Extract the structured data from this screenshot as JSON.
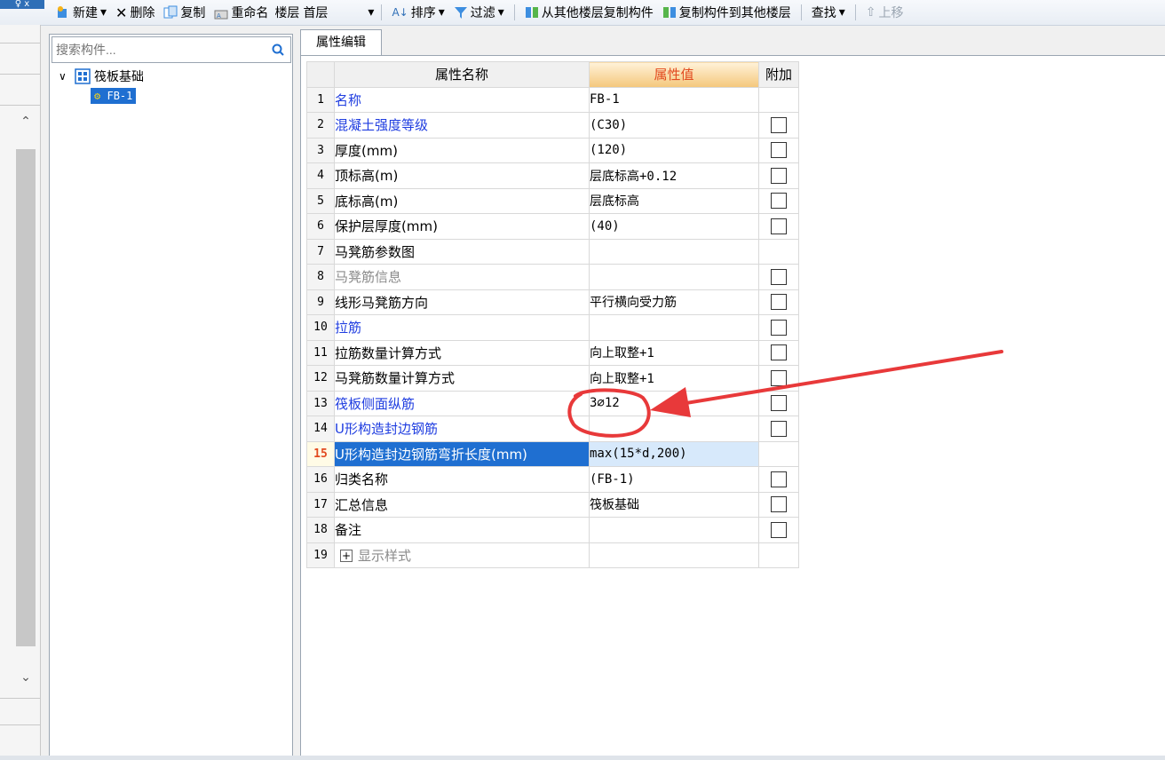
{
  "toolbar": {
    "pin_label": "♀ x",
    "new": "新建",
    "delete": "删除",
    "copy": "复制",
    "rename": "重命名",
    "floor_label": "楼层",
    "floor_value": "首层",
    "sort": "排序",
    "filter": "过滤",
    "copy_from_floor": "从其他楼层复制构件",
    "copy_to_floor": "复制构件到其他楼层",
    "find": "查找",
    "move_up": "上移"
  },
  "components": {
    "search_placeholder": "搜索构件...",
    "tree_root": "筏板基础",
    "tree_child": "FB-1"
  },
  "properties": {
    "tab_label": "属性编辑",
    "headers": {
      "name": "属性名称",
      "value": "属性值",
      "add": "附加"
    },
    "rows": [
      {
        "num": "1",
        "name": "名称",
        "value": "FB-1",
        "checkbox": false,
        "style": "blue"
      },
      {
        "num": "2",
        "name": "混凝土强度等级",
        "value": "(C30)",
        "checkbox": true,
        "style": "blue"
      },
      {
        "num": "3",
        "name": "厚度(mm)",
        "value": "(120)",
        "checkbox": true,
        "style": "normal"
      },
      {
        "num": "4",
        "name": "顶标高(m)",
        "value": "层底标高+0.12",
        "checkbox": true,
        "style": "normal"
      },
      {
        "num": "5",
        "name": "底标高(m)",
        "value": "层底标高",
        "checkbox": true,
        "style": "normal"
      },
      {
        "num": "6",
        "name": "保护层厚度(mm)",
        "value": "(40)",
        "checkbox": true,
        "style": "normal"
      },
      {
        "num": "7",
        "name": "马凳筋参数图",
        "value": "",
        "checkbox": false,
        "style": "normal"
      },
      {
        "num": "8",
        "name": "马凳筋信息",
        "value": "",
        "checkbox": true,
        "style": "gray"
      },
      {
        "num": "9",
        "name": "线形马凳筋方向",
        "value": "平行横向受力筋",
        "checkbox": true,
        "style": "normal"
      },
      {
        "num": "10",
        "name": "拉筋",
        "value": "",
        "checkbox": true,
        "style": "blue"
      },
      {
        "num": "11",
        "name": "拉筋数量计算方式",
        "value": "向上取整+1",
        "checkbox": true,
        "style": "normal"
      },
      {
        "num": "12",
        "name": "马凳筋数量计算方式",
        "value": "向上取整+1",
        "checkbox": true,
        "style": "normal"
      },
      {
        "num": "13",
        "name": "筏板侧面纵筋",
        "value": "3⌀12",
        "checkbox": true,
        "style": "blue"
      },
      {
        "num": "14",
        "name": "U形构造封边钢筋",
        "value": "",
        "checkbox": true,
        "style": "blue"
      },
      {
        "num": "15",
        "name": "U形构造封边钢筋弯折长度(mm)",
        "value": "max(15*d,200)",
        "checkbox": false,
        "style": "selected"
      },
      {
        "num": "16",
        "name": "归类名称",
        "value": "(FB-1)",
        "checkbox": true,
        "style": "normal"
      },
      {
        "num": "17",
        "name": "汇总信息",
        "value": "筏板基础",
        "checkbox": true,
        "style": "normal"
      },
      {
        "num": "18",
        "name": "备注",
        "value": "",
        "checkbox": true,
        "style": "normal"
      },
      {
        "num": "19",
        "name": "显示样式",
        "value": "",
        "checkbox": false,
        "style": "group"
      }
    ]
  },
  "colors": {
    "accent": "#1f6fd1",
    "annotation": "#e8393a",
    "header_value": "#e24a1f",
    "link": "#1f3de0"
  }
}
